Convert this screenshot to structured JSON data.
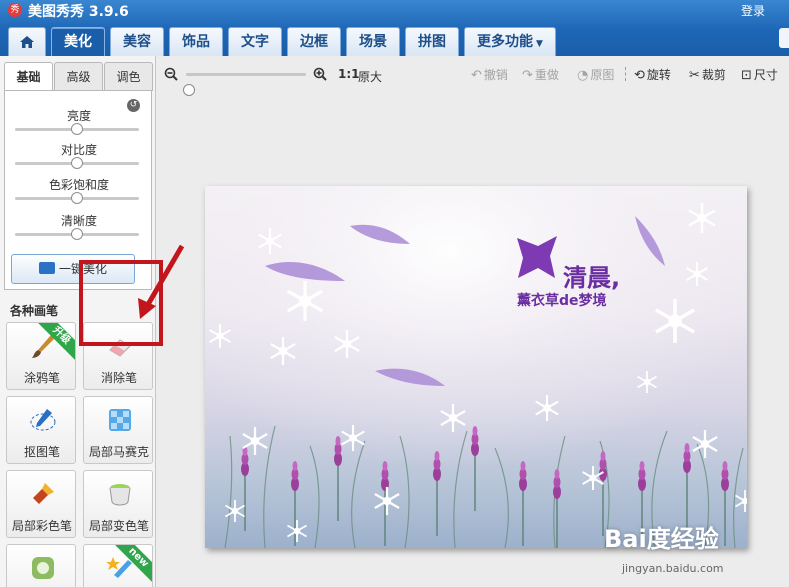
{
  "app": {
    "title": "美图秀秀 3.9.6",
    "logo_text": "秀",
    "login_label": "登录"
  },
  "tabs": [
    {
      "label": "美化",
      "active": true
    },
    {
      "label": "美容"
    },
    {
      "label": "饰品"
    },
    {
      "label": "文字"
    },
    {
      "label": "边框"
    },
    {
      "label": "场景"
    },
    {
      "label": "拼图"
    },
    {
      "label": "更多功能"
    }
  ],
  "panel": {
    "subtabs": [
      "基础",
      "高级",
      "调色"
    ],
    "sliders": [
      {
        "label": "亮度",
        "value": 0.5
      },
      {
        "label": "对比度",
        "value": 0.5
      },
      {
        "label": "色彩饱和度",
        "value": 0.5
      },
      {
        "label": "清晰度",
        "value": 0.5
      }
    ],
    "one_key_label": "一键美化",
    "brushes_title": "各种画笔",
    "brushes": [
      {
        "label": "涂鸦笔",
        "badge": "升级"
      },
      {
        "label": "消除笔",
        "highlighted": true
      },
      {
        "label": "抠图笔"
      },
      {
        "label": "局部马赛克"
      },
      {
        "label": "局部彩色笔"
      },
      {
        "label": "局部变色笔"
      },
      {
        "label": ""
      },
      {
        "label": "",
        "badge": "new"
      }
    ]
  },
  "toolbar": {
    "zoom_value": 0,
    "ratio_label": "1:1",
    "original_size_label": "原大",
    "undo_label": "撤销",
    "redo_label": "重做",
    "original_label": "原图",
    "rotate_label": "旋转",
    "crop_label": "裁剪",
    "size_label": "尺寸"
  },
  "canvas": {
    "title": "清晨,",
    "subtitle": "薰衣草de梦境",
    "watermark": "Bai度经验",
    "watermark_url": "jingyan.baidu.com"
  }
}
